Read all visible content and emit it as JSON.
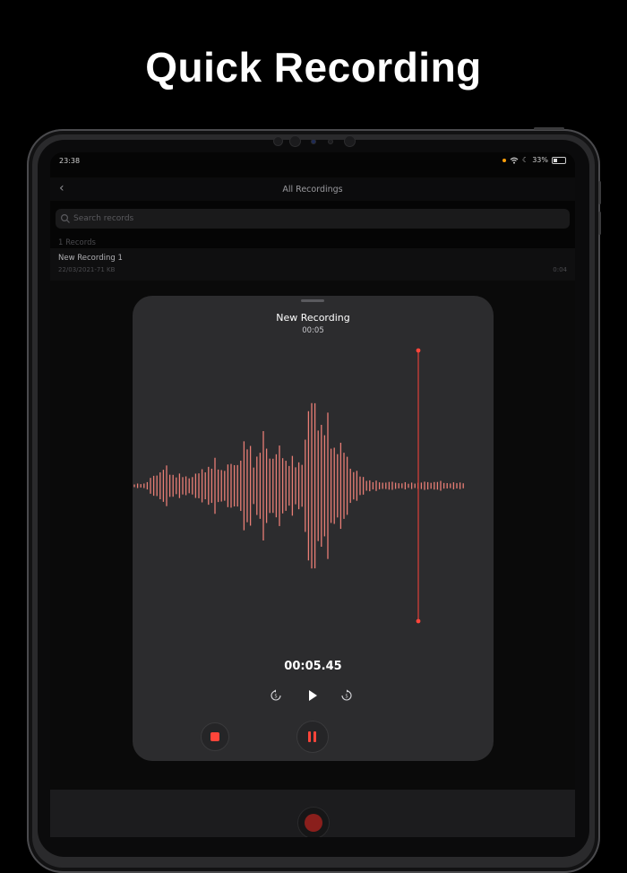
{
  "headline": "Quick Recording",
  "status": {
    "time": "23:38",
    "battery": "33%",
    "battery_level": 0.33
  },
  "nav": {
    "title": "All Recordings"
  },
  "search": {
    "placeholder": "Search records"
  },
  "list": {
    "count_label": "1 Records",
    "items": [
      {
        "name": "New Recording 1",
        "meta": "22/03/2021-71 KB",
        "duration": "0:04"
      }
    ]
  },
  "sheet": {
    "title": "New Recording",
    "elapsed": "00:05",
    "timer": "00:05.45"
  },
  "colors": {
    "accent": "#ff453a",
    "waveform": "#e97e75",
    "sheet_bg": "#2c2c2e"
  },
  "icons": {
    "back": "chevron-left-icon",
    "search": "magnifier-icon",
    "skip_back": "rewind-5-icon",
    "play": "play-icon",
    "skip_forward": "forward-5-icon",
    "stop": "stop-icon",
    "pause": "pause-icon",
    "record": "record-icon"
  }
}
